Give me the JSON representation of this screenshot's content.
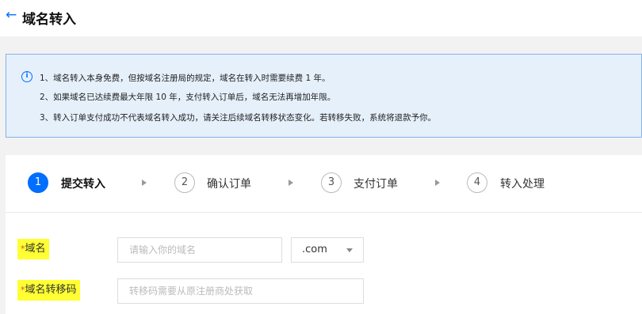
{
  "header": {
    "back_icon": "←",
    "title": "域名转入"
  },
  "notice": {
    "icon": "i",
    "lines": [
      "1、域名转入本身免费，但按域名注册局的规定，域名在转入时需要续费 1 年。",
      "2、如果域名已达续费最大年限 10 年，支付转入订单后，域名无法再增加年限。",
      "3、转入订单支付成功不代表域名转入成功，请关注后续域名转移状态变化。若转移失败，系统将退款予你。"
    ]
  },
  "steps": [
    {
      "number": "1",
      "label": "提交转入",
      "active": true
    },
    {
      "number": "2",
      "label": "确认订单",
      "active": false
    },
    {
      "number": "3",
      "label": "支付订单",
      "active": false
    },
    {
      "number": "4",
      "label": "转入处理",
      "active": false
    }
  ],
  "form": {
    "domain": {
      "required_mark": "*",
      "label": "域名",
      "placeholder": "请输入你的域名",
      "suffix": ".com"
    },
    "transfer_code": {
      "required_mark": "*",
      "label": "域名转移码",
      "placeholder": "转移码需要从原注册商处获取"
    }
  },
  "colors": {
    "accent": "#006eff",
    "highlight": "#ffff33",
    "notice_bg": "#e6f0fb",
    "required": "#e54545"
  }
}
